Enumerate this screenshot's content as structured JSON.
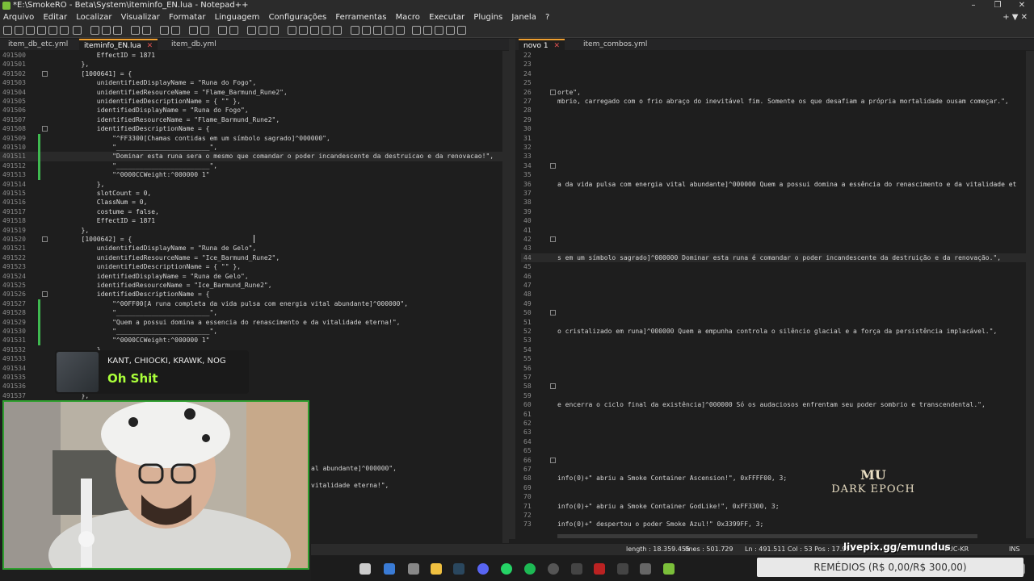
{
  "window": {
    "title": "*E:\\SmokeRO - Beta\\System\\iteminfo_EN.lua - Notepad++",
    "min": "–",
    "max": "❐",
    "close": "✕"
  },
  "menu": [
    "Arquivo",
    "Editar",
    "Localizar",
    "Visualizar",
    "Formatar",
    "Linguagem",
    "Configurações",
    "Ferramentas",
    "Macro",
    "Executar",
    "Plugins",
    "Janela",
    "?"
  ],
  "menu_right": "+ ▼ ✕",
  "left_tabs": [
    {
      "label": "item_db_etc.yml",
      "active": false
    },
    {
      "label": "iteminfo_EN.lua",
      "active": true
    },
    {
      "label": "item_db.yml",
      "active": false
    }
  ],
  "right_tabs": [
    {
      "label": "novo 1",
      "active": true
    },
    {
      "label": "item_combos.yml",
      "active": false
    }
  ],
  "left_editor": {
    "lines": [
      {
        "n": "491500",
        "t": "            EffectID = 1871"
      },
      {
        "n": "491501",
        "t": "        },"
      },
      {
        "n": "491502",
        "t": "        [1000641] = {"
      },
      {
        "n": "491503",
        "t": "            unidentifiedDisplayName = \"Runa do Fogo\","
      },
      {
        "n": "491504",
        "t": "            unidentifiedResourceName = \"Flame_Barmund_Rune2\","
      },
      {
        "n": "491505",
        "t": "            unidentifiedDescriptionName = { \"\" },"
      },
      {
        "n": "491506",
        "t": "            identifiedDisplayName = \"Runa do Fogo\","
      },
      {
        "n": "491507",
        "t": "            identifiedResourceName = \"Flame_Barmund_Rune2\","
      },
      {
        "n": "491508",
        "t": "            identifiedDescriptionName = {"
      },
      {
        "n": "491509",
        "t": "                \"^FF3300[Chamas contidas em um símbolo sagrado]^000000\","
      },
      {
        "n": "491510",
        "t": "                \"________________________\","
      },
      {
        "n": "491511",
        "t": "                \"Dominar esta runa sera o mesmo que comandar o poder incandescente da destruicao e da renovacao!\","
      },
      {
        "n": "491512",
        "t": "                \"________________________\","
      },
      {
        "n": "491513",
        "t": "                \"^0000CCWeight:^000000 1\""
      },
      {
        "n": "491514",
        "t": "            },"
      },
      {
        "n": "491515",
        "t": "            slotCount = 0,"
      },
      {
        "n": "491516",
        "t": "            ClassNum = 0,"
      },
      {
        "n": "491517",
        "t": "            costume = false,"
      },
      {
        "n": "491518",
        "t": "            EffectID = 1871"
      },
      {
        "n": "491519",
        "t": "        },"
      },
      {
        "n": "491520",
        "t": "        [1000642] = {"
      },
      {
        "n": "491521",
        "t": "            unidentifiedDisplayName = \"Runa de Gelo\","
      },
      {
        "n": "491522",
        "t": "            unidentifiedResourceName = \"Ice_Barmund_Rune2\","
      },
      {
        "n": "491523",
        "t": "            unidentifiedDescriptionName = { \"\" },"
      },
      {
        "n": "491524",
        "t": "            identifiedDisplayName = \"Runa de Gelo\","
      },
      {
        "n": "491525",
        "t": "            identifiedResourceName = \"Ice_Barmund_Rune2\","
      },
      {
        "n": "491526",
        "t": "            identifiedDescriptionName = {"
      },
      {
        "n": "491527",
        "t": "                \"^00FF00[A runa completa da vida pulsa com energia vital abundante]^000000\","
      },
      {
        "n": "491528",
        "t": "                \"________________________\","
      },
      {
        "n": "491529",
        "t": "                \"Quem a possui domina a essencia do renascimento e da vitalidade eterna!\","
      },
      {
        "n": "491530",
        "t": "                \"________________________\","
      },
      {
        "n": "491531",
        "t": "                \"^0000CCWeight:^000000 1\""
      },
      {
        "n": "491532",
        "t": "            },"
      },
      {
        "n": "491533",
        "t": ""
      },
      {
        "n": "491534",
        "t": ""
      },
      {
        "n": "491535",
        "t": ""
      },
      {
        "n": "491536",
        "t": ""
      },
      {
        "n": "491537",
        "t": "        },"
      }
    ],
    "hidden_fragments": [
      "al abundante]^000000\",",
      "vitalidade eterna!\","
    ]
  },
  "right_editor": {
    "lines": [
      {
        "n": "22",
        "t": ""
      },
      {
        "n": "23",
        "t": ""
      },
      {
        "n": "24",
        "t": ""
      },
      {
        "n": "25",
        "t": ""
      },
      {
        "n": "26",
        "t": "orte\","
      },
      {
        "n": "27",
        "t": "mbrio, carregado com o frio abraço do inevitável fim. Somente os que desafiam a própria mortalidade ousam começar.\","
      },
      {
        "n": "28",
        "t": ""
      },
      {
        "n": "29",
        "t": ""
      },
      {
        "n": "30",
        "t": ""
      },
      {
        "n": "31",
        "t": ""
      },
      {
        "n": "32",
        "t": ""
      },
      {
        "n": "33",
        "t": ""
      },
      {
        "n": "34",
        "t": ""
      },
      {
        "n": "35",
        "t": ""
      },
      {
        "n": "36",
        "t": "a da vida pulsa com energia vital abundante]^000000 Quem a possui domina a essência do renascimento e da vitalidade et"
      },
      {
        "n": "37",
        "t": ""
      },
      {
        "n": "38",
        "t": ""
      },
      {
        "n": "39",
        "t": ""
      },
      {
        "n": "40",
        "t": ""
      },
      {
        "n": "41",
        "t": ""
      },
      {
        "n": "42",
        "t": ""
      },
      {
        "n": "43",
        "t": ""
      },
      {
        "n": "44",
        "t": "s em um símbolo sagrado]^000000 Dominar esta runa é comandar o poder incandescente da destruição e da renovação.\","
      },
      {
        "n": "45",
        "t": ""
      },
      {
        "n": "46",
        "t": ""
      },
      {
        "n": "47",
        "t": ""
      },
      {
        "n": "48",
        "t": ""
      },
      {
        "n": "49",
        "t": ""
      },
      {
        "n": "50",
        "t": ""
      },
      {
        "n": "51",
        "t": ""
      },
      {
        "n": "52",
        "t": "o cristalizado em runa]^000000 Quem a empunha controla o silêncio glacial e a força da persistência implacável.\","
      },
      {
        "n": "53",
        "t": ""
      },
      {
        "n": "54",
        "t": ""
      },
      {
        "n": "55",
        "t": ""
      },
      {
        "n": "56",
        "t": ""
      },
      {
        "n": "57",
        "t": ""
      },
      {
        "n": "58",
        "t": ""
      },
      {
        "n": "59",
        "t": ""
      },
      {
        "n": "60",
        "t": "e encerra o ciclo final da existência]^000000 Só os audaciosos enfrentam seu poder sombrio e transcendental.\","
      },
      {
        "n": "61",
        "t": ""
      },
      {
        "n": "62",
        "t": ""
      },
      {
        "n": "63",
        "t": ""
      },
      {
        "n": "64",
        "t": ""
      },
      {
        "n": "65",
        "t": ""
      },
      {
        "n": "66",
        "t": ""
      },
      {
        "n": "67",
        "t": ""
      },
      {
        "n": "68",
        "t": "info(0)+\" abriu a Smoke Container Ascension!\", 0xFFFF00, 3;"
      },
      {
        "n": "69",
        "t": ""
      },
      {
        "n": "70",
        "t": ""
      },
      {
        "n": "71",
        "t": "info(0)+\" abriu a Smoke Container GodLike!\", 0xFF3300, 3;"
      },
      {
        "n": "72",
        "t": ""
      },
      {
        "n": "73",
        "t": "info(0)+\" despertou o poder Smoke Azul!\" 0x3399FF, 3;"
      }
    ]
  },
  "status": {
    "length": "length : 18.359.455",
    "lines": "lines : 501.729",
    "pos": "Ln : 491.511   Col : 53   Pos : 17.952",
    "encoding": "EUC-KR",
    "mode": "INS"
  },
  "notification": {
    "artist": "KANT, CHIOCKI, KRAWK, NOG",
    "song": "Oh Shit"
  },
  "overlay": {
    "livepix": "livepix.gg/emundus",
    "goal": "REMÉDIOS (R$ 0,00/R$ 300,00)",
    "logo_top": "MU",
    "logo_bottom": "DARK EPOCH"
  },
  "colors": {
    "accent_tab": "#f0a030",
    "change_marker": "#3fb950",
    "webcam_border": "#2f9e2f",
    "song_color": "#aaff3a"
  }
}
